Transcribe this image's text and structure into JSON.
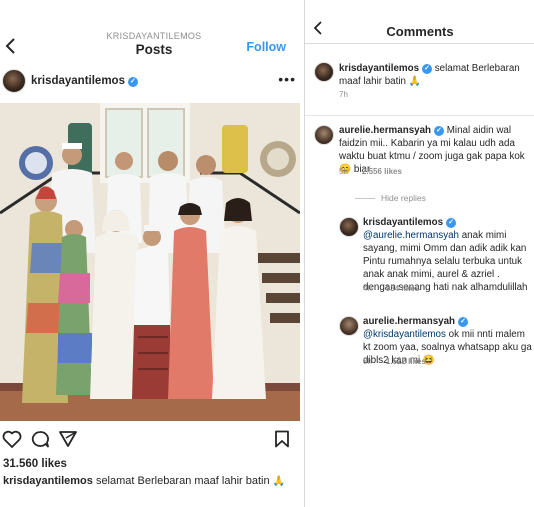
{
  "left": {
    "header": {
      "username": "KRISDAYANTILEMOS",
      "title": "Posts",
      "follow_label": "Follow"
    },
    "profile": {
      "username": "krisdayantilemos"
    },
    "likes": "31.560 likes",
    "caption": {
      "username": "krisdayantilemos",
      "text": "selamat Berlebaran maaf lahir batin"
    }
  },
  "right": {
    "header": {
      "title": "Comments"
    },
    "post": {
      "username": "krisdayantilemos",
      "text": "selamat Berlebaran maaf lahir batin",
      "time": "7h"
    },
    "comments": [
      {
        "username": "aurelie.hermansyah",
        "text": "Minal aidin wal faidzin mii.. Kabarin ya mi kalau udh ada waktu buat ktmu / zoom juga gak papa kok",
        "tail": "biar",
        "time": "5h",
        "likes": "2.556 likes"
      }
    ],
    "hide_replies": "Hide replies",
    "replies": [
      {
        "username": "krisdayantilemos",
        "mention": "@aurelie.hermansyah",
        "text": "anak mimi sayang, mimi Omm dan adik adik kan Pintu rumahnya selalu terbuka untuk anak anak mimi, aurel & azriel . dengan senang hati nak alhamdulillah",
        "time": "4h",
        "likes": "934 likes"
      },
      {
        "username": "aurelie.hermansyah",
        "mention": "@krisdayantilemos",
        "text": "ok mii nnti malem kt zoom yaa, soalnya whatsapp aku ga dibls2 kan mi",
        "time": "3h",
        "likes": "1.522 likes"
      }
    ]
  },
  "colors": {
    "accent": "#3897f0",
    "text": "#262626",
    "muted": "#8e8e8e"
  },
  "icons": [
    "back-chevron-icon",
    "verified-badge-icon",
    "more-options-icon",
    "heart-icon",
    "comment-icon",
    "share-icon",
    "bookmark-icon"
  ]
}
